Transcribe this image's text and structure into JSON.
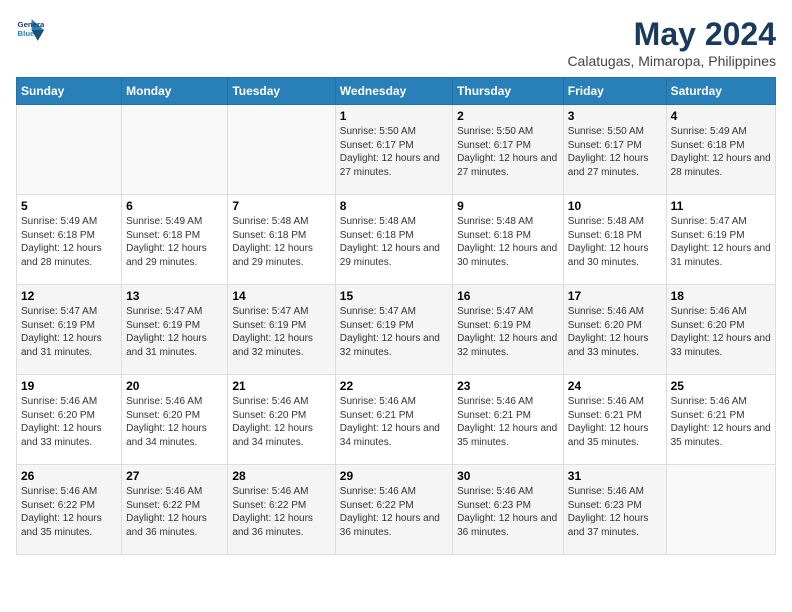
{
  "logo": {
    "line1": "General",
    "line2": "Blue"
  },
  "title": "May 2024",
  "subtitle": "Calatugas, Mimaropa, Philippines",
  "headers": [
    "Sunday",
    "Monday",
    "Tuesday",
    "Wednesday",
    "Thursday",
    "Friday",
    "Saturday"
  ],
  "weeks": [
    [
      {
        "day": "",
        "sunrise": "",
        "sunset": "",
        "daylight": ""
      },
      {
        "day": "",
        "sunrise": "",
        "sunset": "",
        "daylight": ""
      },
      {
        "day": "",
        "sunrise": "",
        "sunset": "",
        "daylight": ""
      },
      {
        "day": "1",
        "sunrise": "Sunrise: 5:50 AM",
        "sunset": "Sunset: 6:17 PM",
        "daylight": "Daylight: 12 hours and 27 minutes."
      },
      {
        "day": "2",
        "sunrise": "Sunrise: 5:50 AM",
        "sunset": "Sunset: 6:17 PM",
        "daylight": "Daylight: 12 hours and 27 minutes."
      },
      {
        "day": "3",
        "sunrise": "Sunrise: 5:50 AM",
        "sunset": "Sunset: 6:17 PM",
        "daylight": "Daylight: 12 hours and 27 minutes."
      },
      {
        "day": "4",
        "sunrise": "Sunrise: 5:49 AM",
        "sunset": "Sunset: 6:18 PM",
        "daylight": "Daylight: 12 hours and 28 minutes."
      }
    ],
    [
      {
        "day": "5",
        "sunrise": "Sunrise: 5:49 AM",
        "sunset": "Sunset: 6:18 PM",
        "daylight": "Daylight: 12 hours and 28 minutes."
      },
      {
        "day": "6",
        "sunrise": "Sunrise: 5:49 AM",
        "sunset": "Sunset: 6:18 PM",
        "daylight": "Daylight: 12 hours and 29 minutes."
      },
      {
        "day": "7",
        "sunrise": "Sunrise: 5:48 AM",
        "sunset": "Sunset: 6:18 PM",
        "daylight": "Daylight: 12 hours and 29 minutes."
      },
      {
        "day": "8",
        "sunrise": "Sunrise: 5:48 AM",
        "sunset": "Sunset: 6:18 PM",
        "daylight": "Daylight: 12 hours and 29 minutes."
      },
      {
        "day": "9",
        "sunrise": "Sunrise: 5:48 AM",
        "sunset": "Sunset: 6:18 PM",
        "daylight": "Daylight: 12 hours and 30 minutes."
      },
      {
        "day": "10",
        "sunrise": "Sunrise: 5:48 AM",
        "sunset": "Sunset: 6:18 PM",
        "daylight": "Daylight: 12 hours and 30 minutes."
      },
      {
        "day": "11",
        "sunrise": "Sunrise: 5:47 AM",
        "sunset": "Sunset: 6:19 PM",
        "daylight": "Daylight: 12 hours and 31 minutes."
      }
    ],
    [
      {
        "day": "12",
        "sunrise": "Sunrise: 5:47 AM",
        "sunset": "Sunset: 6:19 PM",
        "daylight": "Daylight: 12 hours and 31 minutes."
      },
      {
        "day": "13",
        "sunrise": "Sunrise: 5:47 AM",
        "sunset": "Sunset: 6:19 PM",
        "daylight": "Daylight: 12 hours and 31 minutes."
      },
      {
        "day": "14",
        "sunrise": "Sunrise: 5:47 AM",
        "sunset": "Sunset: 6:19 PM",
        "daylight": "Daylight: 12 hours and 32 minutes."
      },
      {
        "day": "15",
        "sunrise": "Sunrise: 5:47 AM",
        "sunset": "Sunset: 6:19 PM",
        "daylight": "Daylight: 12 hours and 32 minutes."
      },
      {
        "day": "16",
        "sunrise": "Sunrise: 5:47 AM",
        "sunset": "Sunset: 6:19 PM",
        "daylight": "Daylight: 12 hours and 32 minutes."
      },
      {
        "day": "17",
        "sunrise": "Sunrise: 5:46 AM",
        "sunset": "Sunset: 6:20 PM",
        "daylight": "Daylight: 12 hours and 33 minutes."
      },
      {
        "day": "18",
        "sunrise": "Sunrise: 5:46 AM",
        "sunset": "Sunset: 6:20 PM",
        "daylight": "Daylight: 12 hours and 33 minutes."
      }
    ],
    [
      {
        "day": "19",
        "sunrise": "Sunrise: 5:46 AM",
        "sunset": "Sunset: 6:20 PM",
        "daylight": "Daylight: 12 hours and 33 minutes."
      },
      {
        "day": "20",
        "sunrise": "Sunrise: 5:46 AM",
        "sunset": "Sunset: 6:20 PM",
        "daylight": "Daylight: 12 hours and 34 minutes."
      },
      {
        "day": "21",
        "sunrise": "Sunrise: 5:46 AM",
        "sunset": "Sunset: 6:20 PM",
        "daylight": "Daylight: 12 hours and 34 minutes."
      },
      {
        "day": "22",
        "sunrise": "Sunrise: 5:46 AM",
        "sunset": "Sunset: 6:21 PM",
        "daylight": "Daylight: 12 hours and 34 minutes."
      },
      {
        "day": "23",
        "sunrise": "Sunrise: 5:46 AM",
        "sunset": "Sunset: 6:21 PM",
        "daylight": "Daylight: 12 hours and 35 minutes."
      },
      {
        "day": "24",
        "sunrise": "Sunrise: 5:46 AM",
        "sunset": "Sunset: 6:21 PM",
        "daylight": "Daylight: 12 hours and 35 minutes."
      },
      {
        "day": "25",
        "sunrise": "Sunrise: 5:46 AM",
        "sunset": "Sunset: 6:21 PM",
        "daylight": "Daylight: 12 hours and 35 minutes."
      }
    ],
    [
      {
        "day": "26",
        "sunrise": "Sunrise: 5:46 AM",
        "sunset": "Sunset: 6:22 PM",
        "daylight": "Daylight: 12 hours and 35 minutes."
      },
      {
        "day": "27",
        "sunrise": "Sunrise: 5:46 AM",
        "sunset": "Sunset: 6:22 PM",
        "daylight": "Daylight: 12 hours and 36 minutes."
      },
      {
        "day": "28",
        "sunrise": "Sunrise: 5:46 AM",
        "sunset": "Sunset: 6:22 PM",
        "daylight": "Daylight: 12 hours and 36 minutes."
      },
      {
        "day": "29",
        "sunrise": "Sunrise: 5:46 AM",
        "sunset": "Sunset: 6:22 PM",
        "daylight": "Daylight: 12 hours and 36 minutes."
      },
      {
        "day": "30",
        "sunrise": "Sunrise: 5:46 AM",
        "sunset": "Sunset: 6:23 PM",
        "daylight": "Daylight: 12 hours and 36 minutes."
      },
      {
        "day": "31",
        "sunrise": "Sunrise: 5:46 AM",
        "sunset": "Sunset: 6:23 PM",
        "daylight": "Daylight: 12 hours and 37 minutes."
      },
      {
        "day": "",
        "sunrise": "",
        "sunset": "",
        "daylight": ""
      }
    ]
  ]
}
